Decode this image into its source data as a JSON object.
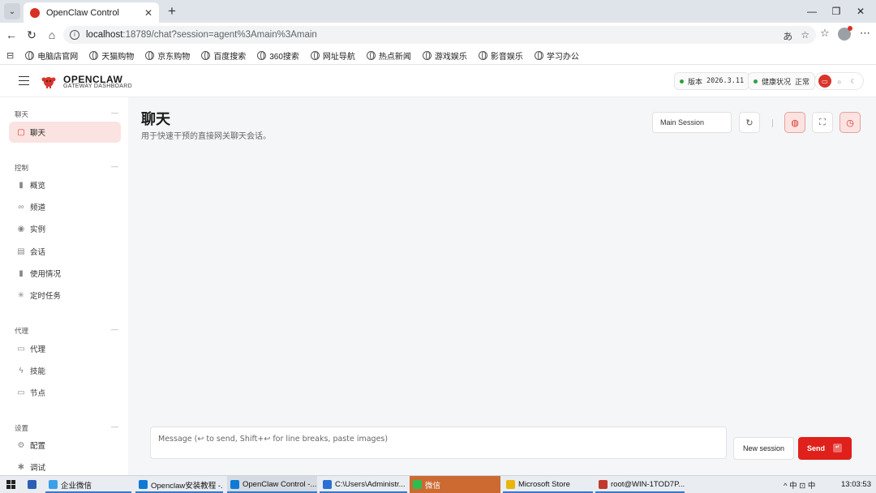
{
  "browser": {
    "tab_title": "OpenClaw Control",
    "url_host": "localhost",
    "url_path": ":18789/chat?session=agent%3Amain%3Amain",
    "bookmarks": [
      "电脑店官网",
      "天猫购物",
      "京东购物",
      "百度搜索",
      "360搜索",
      "网址导航",
      "热点新闻",
      "游戏娱乐",
      "影音娱乐",
      "学习办公"
    ]
  },
  "header": {
    "brand_name": "OPENCLAW",
    "brand_sub": "GATEWAY DASHBOARD",
    "version_label": "版本",
    "version_value": "2026.3.11",
    "health_label": "健康状况",
    "health_value": "正常"
  },
  "sidebar": {
    "sections": [
      {
        "title": "聊天",
        "items": [
          {
            "label": "聊天",
            "icon": "chat-bubble-icon",
            "active": true
          }
        ]
      },
      {
        "title": "控制",
        "items": [
          {
            "label": "概览",
            "icon": "bar-chart-icon"
          },
          {
            "label": "频道",
            "icon": "link-icon"
          },
          {
            "label": "实例",
            "icon": "radio-icon"
          },
          {
            "label": "会话",
            "icon": "document-icon"
          },
          {
            "label": "使用情况",
            "icon": "bar-chart-icon"
          },
          {
            "label": "定时任务",
            "icon": "loader-icon"
          }
        ]
      },
      {
        "title": "代理",
        "items": [
          {
            "label": "代理",
            "icon": "folder-icon"
          },
          {
            "label": "技能",
            "icon": "bolt-icon"
          },
          {
            "label": "节点",
            "icon": "monitor-icon"
          }
        ]
      },
      {
        "title": "设置",
        "items": [
          {
            "label": "配置",
            "icon": "gear-icon"
          },
          {
            "label": "调试",
            "icon": "bug-icon"
          }
        ]
      }
    ]
  },
  "main": {
    "title": "聊天",
    "subtitle": "用于快速干预的直接网关聊天会话。",
    "session_select": "Main Session",
    "composer_placeholder": "Message (↩ to send, Shift+↩ for line breaks, paste images)",
    "new_session_label": "New session",
    "send_label": "Send"
  },
  "taskbar": {
    "items": [
      "企业微信",
      "Openclaw安装教程 -...",
      "OpenClaw Control -...",
      "C:\\Users\\Administr...",
      "微信",
      "Microsoft Store",
      "root@WIN-1TOD7P..."
    ],
    "tray": "^ 中 ⊡ 中",
    "clock": "13:03:53"
  },
  "colors": {
    "accent": "#d9342b",
    "send": "#e0201b",
    "active_nav_bg": "#fbe3e1",
    "health_ok": "#2ea043"
  }
}
